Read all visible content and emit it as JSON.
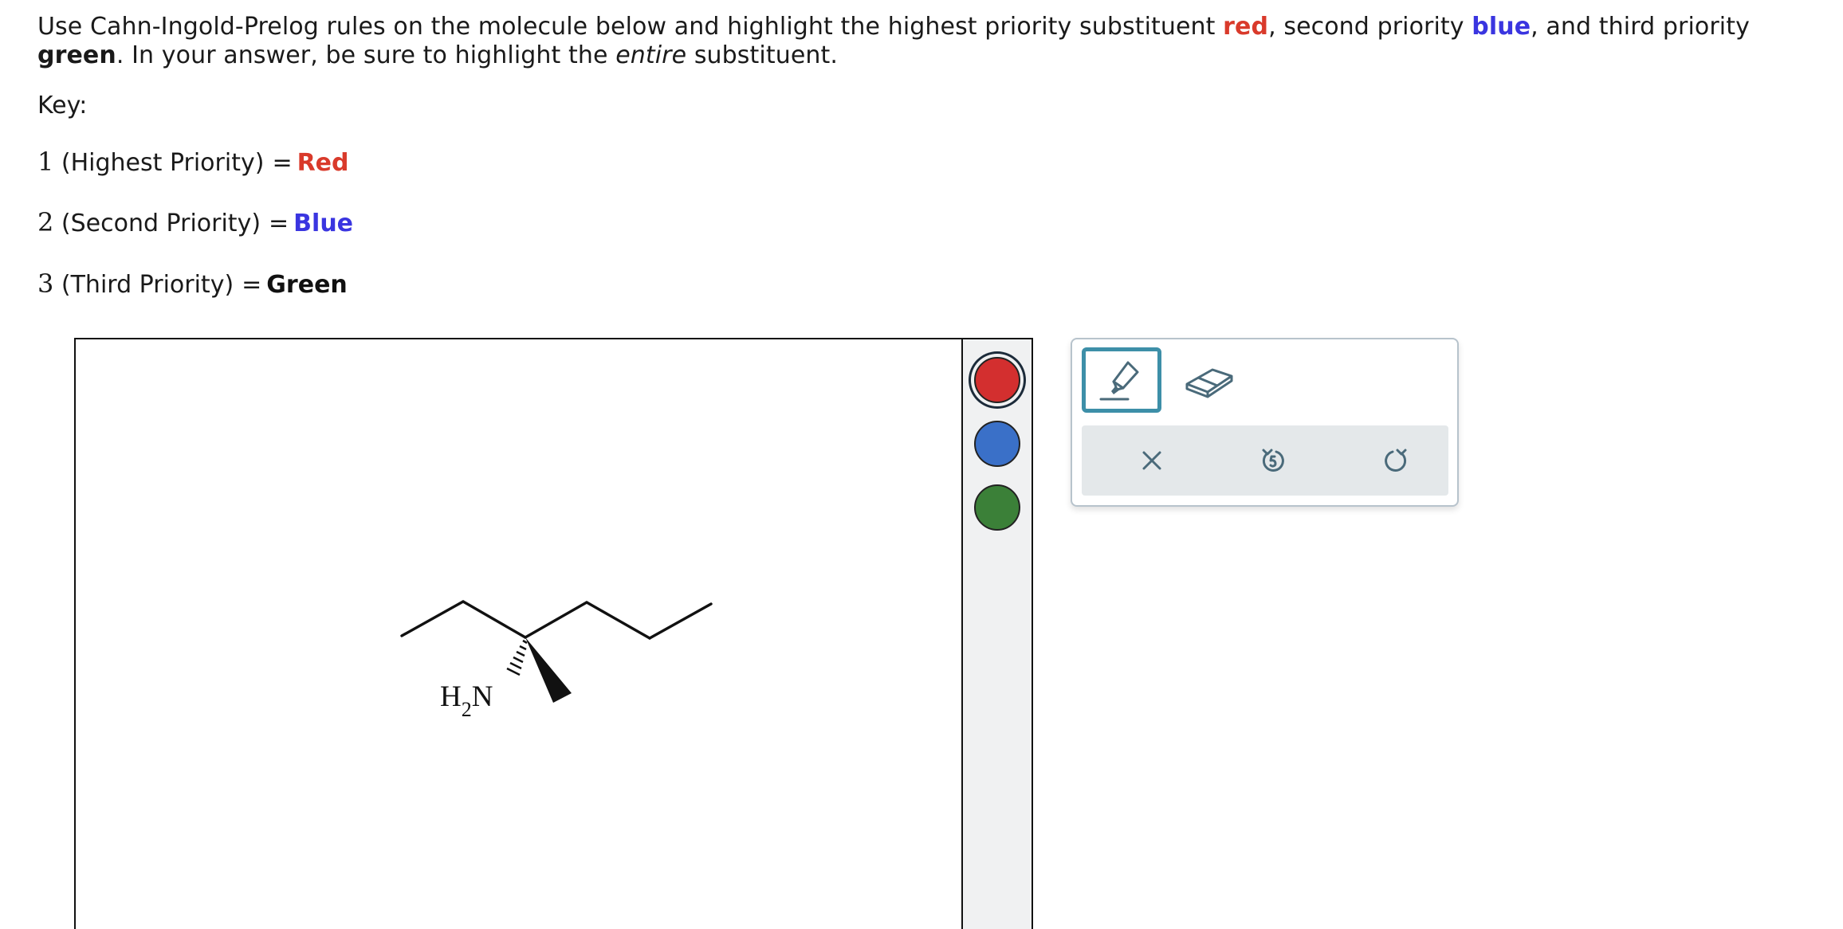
{
  "question": {
    "part1": "Use Cahn-Ingold-Prelog rules on the molecule below and highlight the highest priority substituent ",
    "red_word": "red",
    "part2": ", second priority ",
    "blue_word": "blue",
    "part3": ", and third priority ",
    "green_word": "green",
    "part4": ". In your answer, be sure to highlight the ",
    "emphasis": "entire",
    "part5": " substituent."
  },
  "key": {
    "label": "Key:",
    "rows": [
      {
        "num": "1",
        "text": "(Highest Priority)",
        "eq": "=",
        "value": "Red"
      },
      {
        "num": "2",
        "text": "(Second Priority)",
        "eq": "=",
        "value": "Blue"
      },
      {
        "num": "3",
        "text": "(Third Priority)",
        "eq": "=",
        "value": "Green"
      }
    ]
  },
  "molecule": {
    "amine_h": "H",
    "amine_sub": "2",
    "amine_n": "N"
  },
  "palette": {
    "colors": [
      {
        "name": "red",
        "hex": "#d32f2f",
        "selected": true
      },
      {
        "name": "blue",
        "hex": "#3a70c8",
        "selected": false
      },
      {
        "name": "green",
        "hex": "#3b8038",
        "selected": false
      }
    ]
  },
  "tools": {
    "active": "highlighter",
    "items": [
      "highlighter-icon",
      "eraser-icon"
    ],
    "actions": [
      "clear-icon",
      "undo-icon",
      "redo-icon"
    ],
    "accent": "#3d8fa8",
    "icon_color": "#4a6a7a"
  }
}
